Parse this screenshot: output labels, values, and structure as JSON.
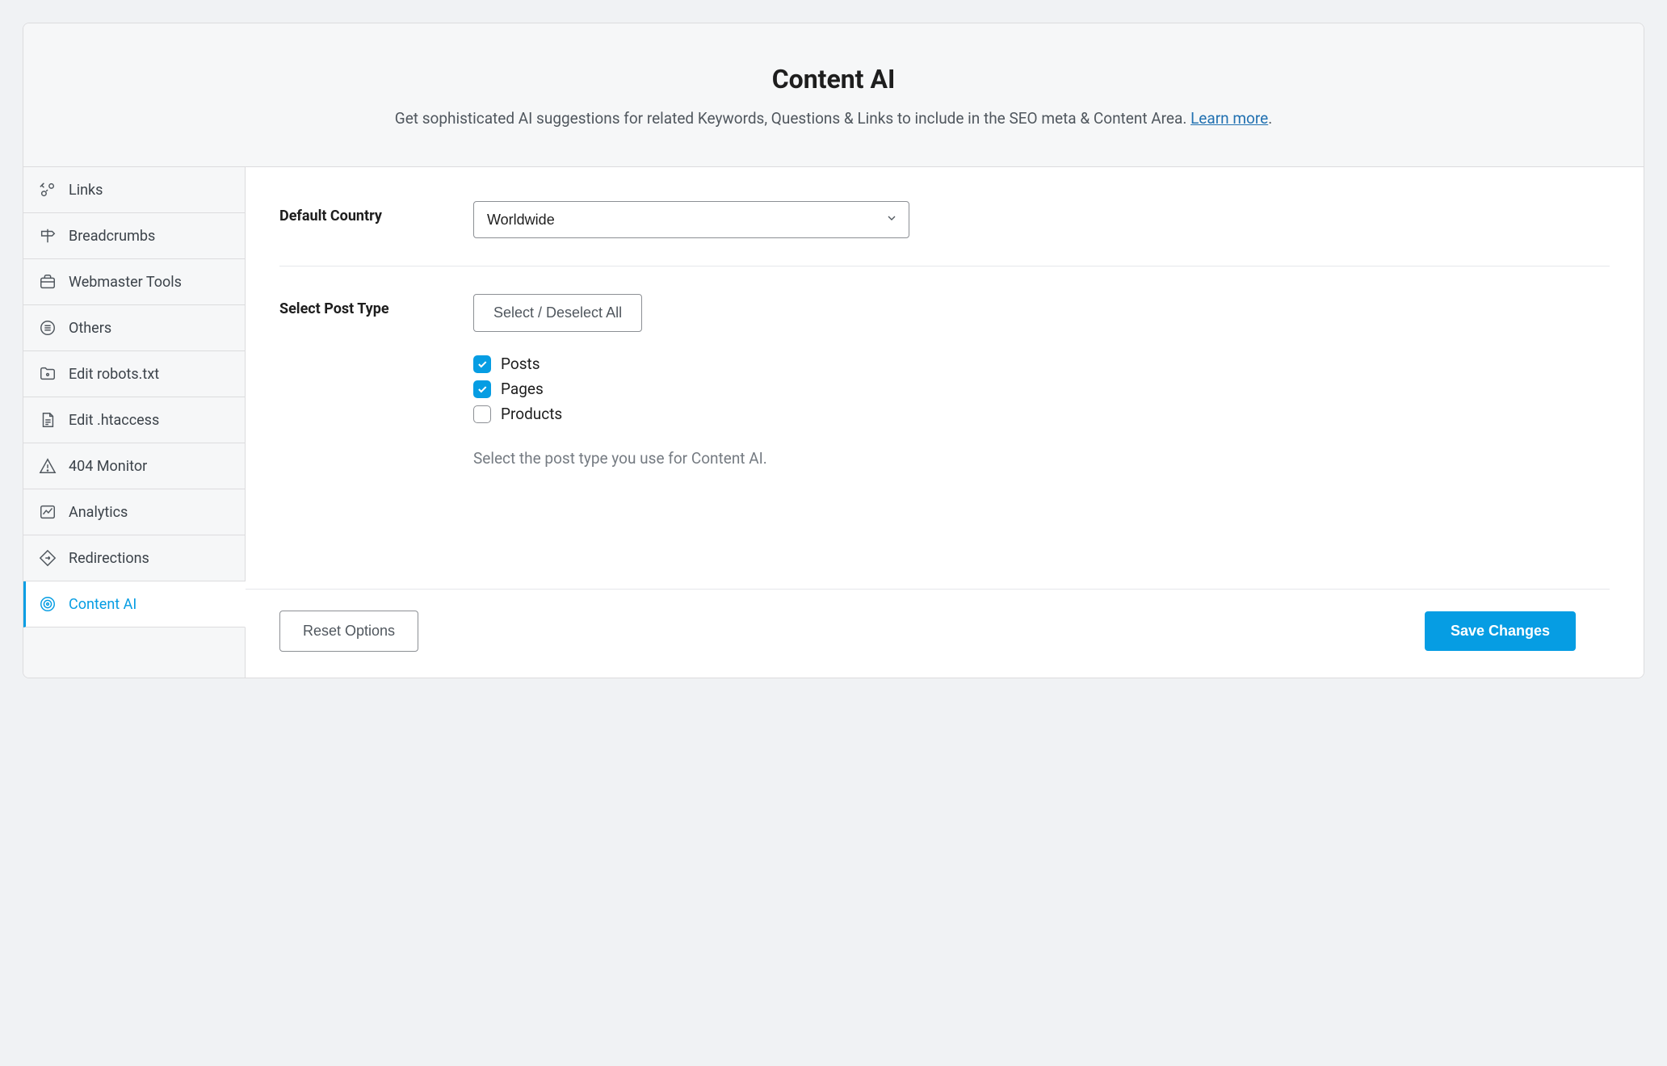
{
  "header": {
    "title": "Content AI",
    "description": "Get sophisticated AI suggestions for related Keywords, Questions & Links to include in the SEO meta & Content Area. ",
    "learn_more": "Learn more"
  },
  "sidebar": {
    "items": [
      {
        "label": "Links",
        "icon": "links-icon",
        "active": false
      },
      {
        "label": "Breadcrumbs",
        "icon": "signpost-icon",
        "active": false
      },
      {
        "label": "Webmaster Tools",
        "icon": "briefcase-icon",
        "active": false
      },
      {
        "label": "Others",
        "icon": "circle-lines-icon",
        "active": false
      },
      {
        "label": "Edit robots.txt",
        "icon": "folder-icon",
        "active": false
      },
      {
        "label": "Edit .htaccess",
        "icon": "document-lines-icon",
        "active": false
      },
      {
        "label": "404 Monitor",
        "icon": "warning-triangle-icon",
        "active": false
      },
      {
        "label": "Analytics",
        "icon": "chart-line-icon",
        "active": false
      },
      {
        "label": "Redirections",
        "icon": "diamond-arrow-icon",
        "active": false
      },
      {
        "label": "Content AI",
        "icon": "target-icon",
        "active": true
      }
    ]
  },
  "form": {
    "default_country": {
      "label": "Default Country",
      "value": "Worldwide"
    },
    "select_post_type": {
      "label": "Select Post Type",
      "toggle_all": "Select / Deselect All",
      "options": [
        {
          "label": "Posts",
          "checked": true
        },
        {
          "label": "Pages",
          "checked": true
        },
        {
          "label": "Products",
          "checked": false
        }
      ],
      "help": "Select the post type you use for Content AI."
    }
  },
  "footer": {
    "reset": "Reset Options",
    "save": "Save Changes"
  }
}
